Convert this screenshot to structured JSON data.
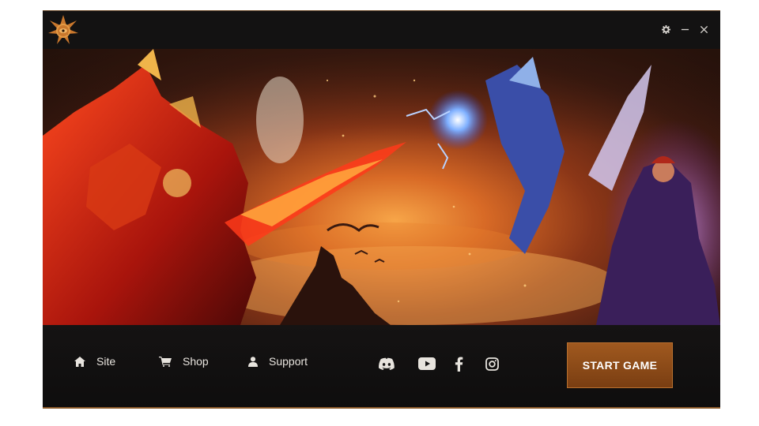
{
  "titlebar": {
    "logo_icon": "star-emblem-icon",
    "controls": [
      {
        "name": "settings",
        "icon": "gear-icon"
      },
      {
        "name": "minimize",
        "icon": "minimize-icon"
      },
      {
        "name": "close",
        "icon": "close-icon"
      }
    ]
  },
  "banner": {
    "description_icon": "game-artwork"
  },
  "nav": {
    "site_label": "Site",
    "shop_label": "Shop",
    "support_label": "Support"
  },
  "social": [
    {
      "name": "discord",
      "icon": "discord-icon"
    },
    {
      "name": "youtube",
      "icon": "youtube-icon"
    },
    {
      "name": "facebook",
      "icon": "facebook-icon"
    },
    {
      "name": "instagram",
      "icon": "instagram-icon"
    }
  ],
  "start_button": {
    "label": "START GAME"
  },
  "colors": {
    "accent": "#9a551d",
    "background": "#111010",
    "text": "#e8e4de"
  }
}
